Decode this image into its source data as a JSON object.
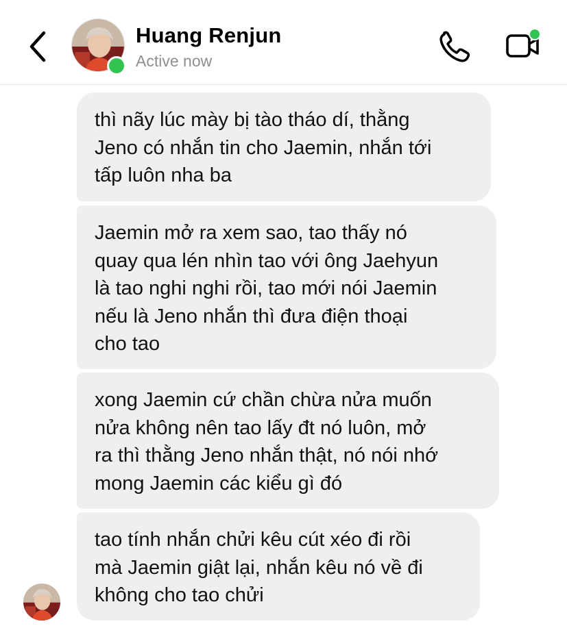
{
  "header": {
    "contact_name": "Huang Renjun",
    "status": "Active now",
    "back_icon": "chevron-left-icon",
    "call_icon": "phone-icon",
    "video_icon": "video-camera-icon",
    "online_color": "#31c452"
  },
  "messages": [
    {
      "text": "thì nãy lúc mày bị tào tháo dí, thằng\nJeno có nhắn tin cho Jaemin, nhắn tới\ntấp luôn nha ba"
    },
    {
      "text": "Jaemin mở ra xem sao, tao thấy nó\nquay qua lén nhìn tao với ông Jaehyun\nlà tao nghi nghi rồi, tao mới nói Jaemin\nnếu là Jeno nhắn thì đưa điện thoại\ncho tao"
    },
    {
      "text": "xong Jaemin cứ chần chừa nửa muốn\nnửa không nên tao lấy đt nó luôn, mở\nra thì thằng Jeno nhắn thật, nó nói nhớ\nmong Jaemin các kiểu gì đó"
    },
    {
      "text": "tao tính nhắn chửi kêu cút xéo đi rồi\nmà Jaemin giật lại, nhắn kêu nó về đi\nkhông cho tao chửi"
    }
  ],
  "colors": {
    "bubble_bg": "#efefef",
    "status_text": "#8e8e8e"
  }
}
